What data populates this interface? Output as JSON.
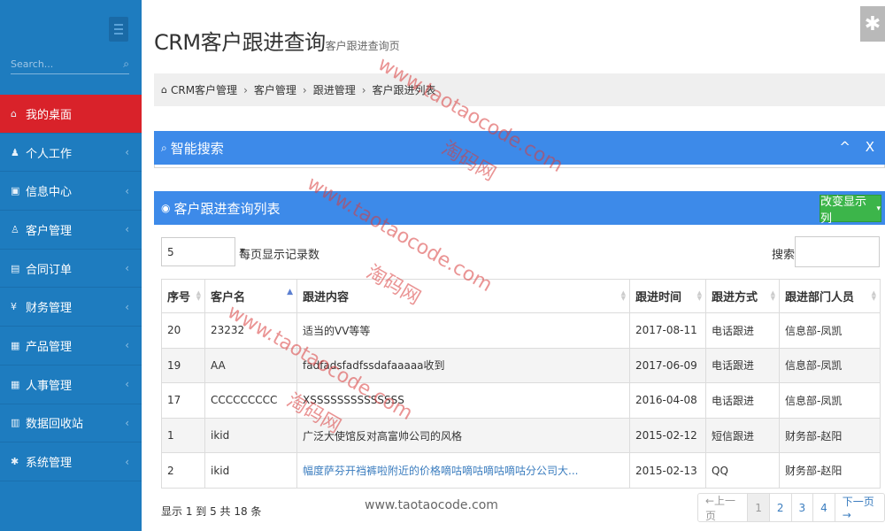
{
  "sidebar": {
    "search_placeholder": "Search...",
    "items": [
      {
        "label": "我的桌面",
        "icon": "home-icon",
        "glyph": "⌂",
        "active": true
      },
      {
        "label": "个人工作",
        "icon": "user-icon",
        "glyph": "♟"
      },
      {
        "label": "信息中心",
        "icon": "inbox-icon",
        "glyph": "▣"
      },
      {
        "label": "客户管理",
        "icon": "person-icon",
        "glyph": "♙"
      },
      {
        "label": "合同订单",
        "icon": "book-icon",
        "glyph": "▤"
      },
      {
        "label": "财务管理",
        "icon": "yen-icon",
        "glyph": "¥"
      },
      {
        "label": "产品管理",
        "icon": "grid-icon",
        "glyph": "▦"
      },
      {
        "label": "人事管理",
        "icon": "grid-icon",
        "glyph": "▦"
      },
      {
        "label": "数据回收站",
        "icon": "trash-icon",
        "glyph": "▥"
      },
      {
        "label": "系统管理",
        "icon": "gear-icon",
        "glyph": "✱"
      }
    ]
  },
  "header": {
    "title": "CRM客户跟进查询",
    "subtitle": "客户跟进查询页"
  },
  "breadcrumb": [
    "CRM客户管理",
    "客户管理",
    "跟进管理",
    "客户跟进列表"
  ],
  "smart_search": {
    "title": "智能搜索",
    "tools": "^ X"
  },
  "list_panel": {
    "title": "客户跟进查询列表",
    "change_button": "改变显示列"
  },
  "length": {
    "value": "5",
    "label": "每页显示记录数"
  },
  "search": {
    "label": "搜索:"
  },
  "table": {
    "headers": [
      "序号",
      "客户名",
      "跟进内容",
      "跟进时间",
      "跟进方式",
      "跟进部门人员"
    ],
    "rows": [
      [
        "20",
        "23232",
        "适当的VV等等",
        "2017-08-11",
        "电话跟进",
        "信息部-凤凯"
      ],
      [
        "19",
        "AA",
        "fadfadsfadfssdafaaaaa收到",
        "2017-06-09",
        "电话跟进",
        "信息部-凤凯"
      ],
      [
        "17",
        "CCCCCCCCC",
        "XSSSSSSSSSSSSSS",
        "2016-04-08",
        "电话跟进",
        "信息部-凤凯"
      ],
      [
        "1",
        "ikid",
        "广泛大使馆反对高富帅公司的风格",
        "2015-02-12",
        "短信跟进",
        "财务部-赵阳"
      ],
      [
        "2",
        "ikid",
        "幅度萨芬开裆裤啦附近的价格嘀咕嘀咕嘀咕嘀咕分公司大...",
        "2015-02-13",
        "QQ",
        "财务部-赵阳"
      ]
    ]
  },
  "footer": {
    "info": "显示 1 到 5 共 18 条",
    "pager": [
      "←上一页",
      "1",
      "2",
      "3",
      "4",
      "下一页→"
    ]
  },
  "watermarks": {
    "url": "www.taotaocode.com",
    "cn": "淘码网"
  }
}
